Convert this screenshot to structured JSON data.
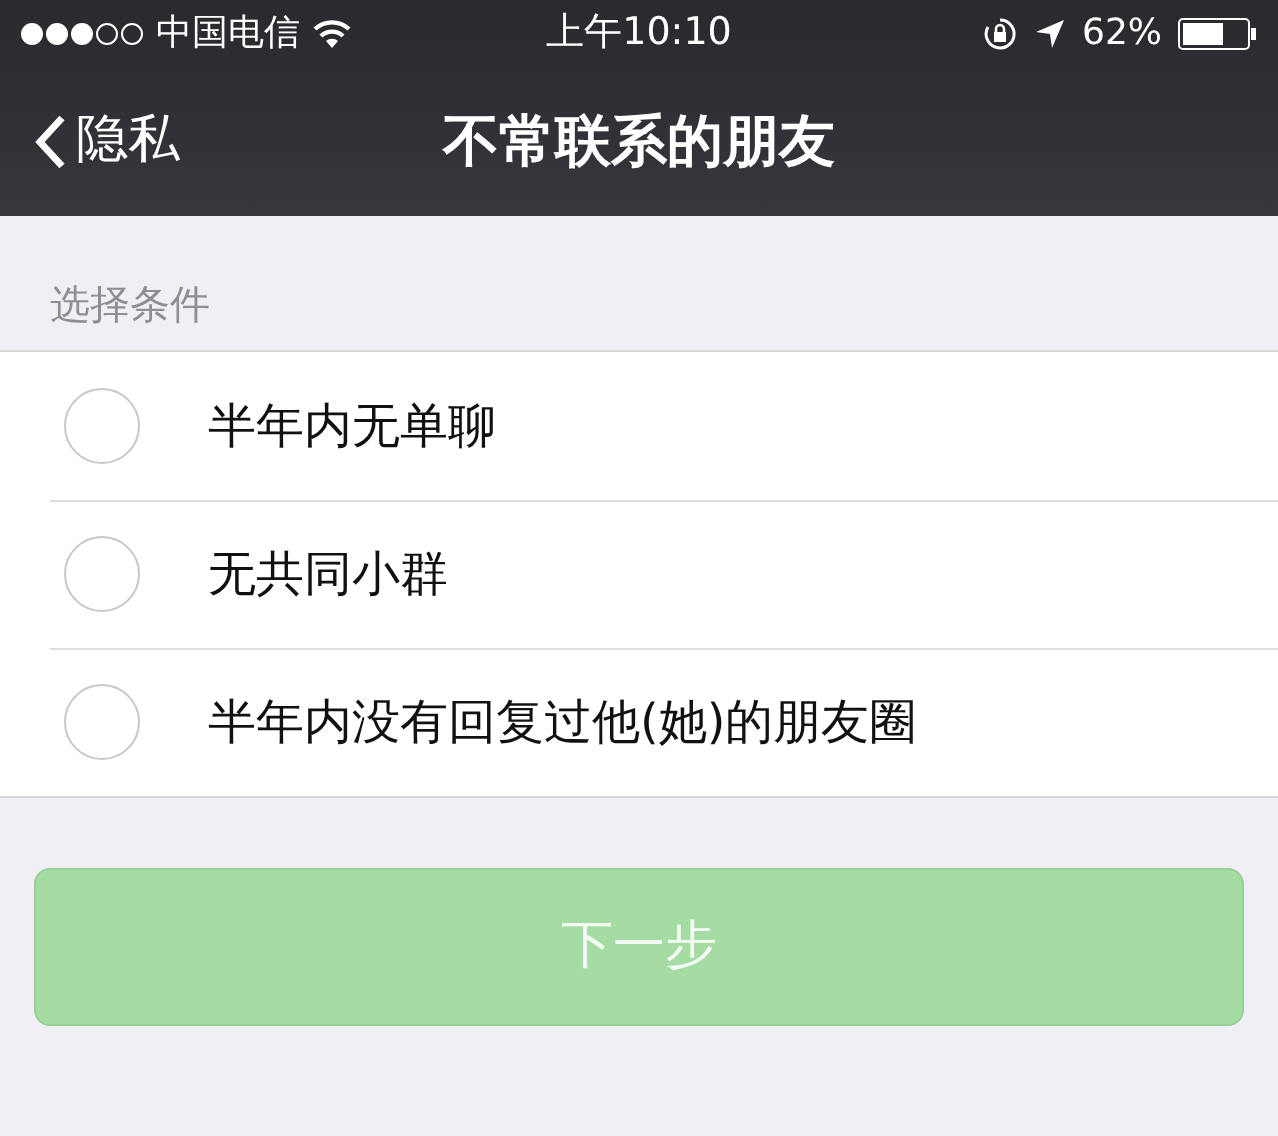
{
  "status_bar": {
    "carrier": "中国电信",
    "time": "上午10:10",
    "battery": "62%"
  },
  "nav": {
    "back": "隐私",
    "title": "不常联系的朋友"
  },
  "section": {
    "header": "选择条件"
  },
  "options": [
    {
      "label": "半年内无单聊",
      "selected": false
    },
    {
      "label": "无共同小群",
      "selected": false
    },
    {
      "label": "半年内没有回复过他(她)的朋友圈",
      "selected": false
    }
  ],
  "next_button": {
    "label": "下一步",
    "disabled": true
  }
}
